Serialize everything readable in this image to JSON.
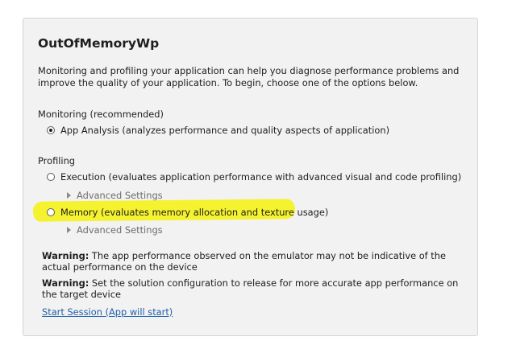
{
  "panel": {
    "title": "OutOfMemoryWp",
    "intro": "Monitoring and profiling your application can help you diagnose performance problems and improve the quality of your application. To begin, choose one of the options below."
  },
  "monitoring": {
    "label": "Monitoring (recommended)",
    "options": [
      {
        "label": "App Analysis (analyzes performance and quality aspects of application)",
        "checked": true
      }
    ]
  },
  "profiling": {
    "label": "Profiling",
    "options": [
      {
        "label": "Execution (evaluates application performance with advanced visual and code profiling)",
        "checked": false,
        "advanced_label": "Advanced Settings"
      },
      {
        "label": "Memory (evaluates memory allocation and texture usage)",
        "checked": false,
        "advanced_label": "Advanced Settings",
        "highlighted": true
      }
    ]
  },
  "warnings": [
    {
      "prefix": "Warning:",
      "text": " The app performance observed on the emulator may not be indicative of the actual performance on the device"
    },
    {
      "prefix": "Warning:",
      "text": " Set the solution configuration to release for more accurate app performance on the target device"
    }
  ],
  "start_link": "Start Session (App will start)",
  "colors": {
    "panel_background": "#f2f2f3",
    "highlight": "#f5f230",
    "link": "#1e5fa8"
  }
}
